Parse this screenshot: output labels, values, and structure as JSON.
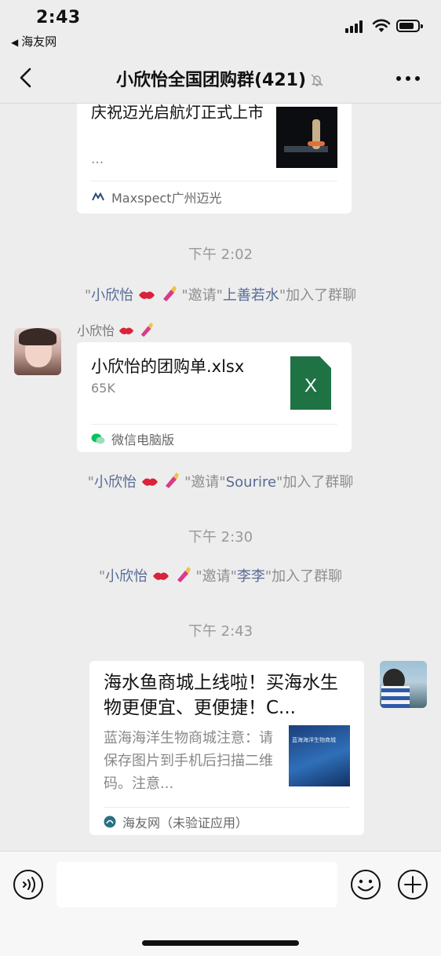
{
  "status": {
    "time": "2:43",
    "back_app": "海友网"
  },
  "nav": {
    "title": "小欣怡全国团购群(421)"
  },
  "messages": {
    "link1": {
      "title": "庆祝迈光启航灯正式上市",
      "ellipsis": "...",
      "source": "Maxspect广州迈光"
    },
    "ts1": "下午 2:02",
    "sys1": {
      "q1": "\"",
      "inviter": "小欣怡",
      "mid": "\"邀请\"",
      "invitee": "上善若水",
      "tail": "\"加入了群聊"
    },
    "file_msg": {
      "sender": "小欣怡",
      "filename": "小欣怡的团购单.xlsx",
      "size": "65K",
      "icon_letter": "X",
      "source": "微信电脑版"
    },
    "sys2": {
      "q1": "\"",
      "inviter": "小欣怡",
      "mid": "\"邀请\"",
      "invitee": "Sourire",
      "tail": "\"加入了群聊"
    },
    "ts2": "下午 2:30",
    "sys3": {
      "q1": "\"",
      "inviter": "小欣怡",
      "mid": "\"邀请\"",
      "invitee": "李李",
      "tail": "\"加入了群聊"
    },
    "ts3": "下午 2:43",
    "link2": {
      "title": "海水鱼商城上线啦！买海水生物更便宜、更便捷！C...",
      "desc": "蓝海海洋生物商城注意：请保存图片到手机后扫描二维码。注意...",
      "thumb_text": "蓝海海洋生物商城",
      "source": "海友网（未验证应用）"
    }
  },
  "input": {
    "placeholder": ""
  },
  "colors": {
    "background": "#ededed",
    "link_name": "#576b95",
    "excel_green": "#1f7244",
    "wechat_green": "#07c160"
  }
}
